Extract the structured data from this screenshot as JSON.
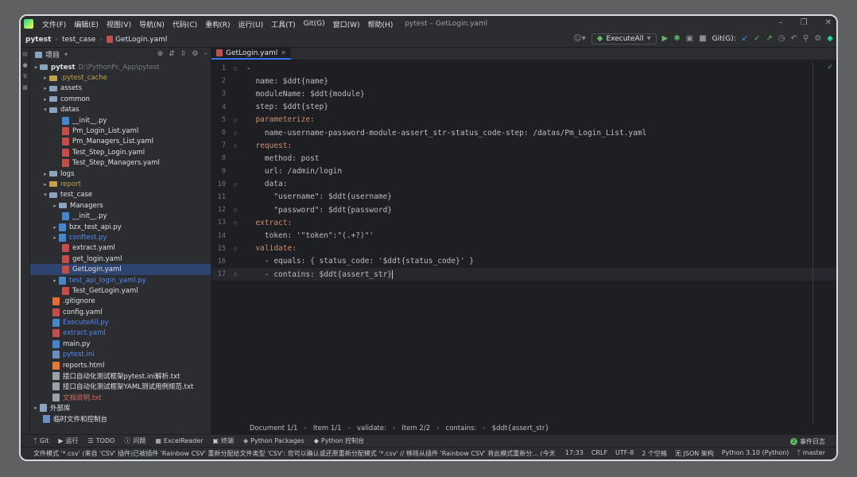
{
  "titlebar": {
    "menus": [
      "文件(F)",
      "编辑(E)",
      "视图(V)",
      "导航(N)",
      "代码(C)",
      "重构(R)",
      "运行(U)",
      "工具(T)",
      "Git(G)",
      "窗口(W)",
      "帮助(H)"
    ],
    "title": "pytest – GetLogin.yaml"
  },
  "navbar": {
    "crumbs": [
      "pytest",
      "test_case",
      "GetLogin.yaml"
    ],
    "run_config": "ExecuteAll",
    "git_label": "Git(G):"
  },
  "project": {
    "header": "项目",
    "root_name": "pytest",
    "root_path": "D:\\PythonPc_App\\pytest",
    "items": [
      {
        "label": ".pytest_cache"
      },
      {
        "label": "assets"
      },
      {
        "label": "common"
      },
      {
        "label": "datas"
      },
      {
        "label": "__init__.py"
      },
      {
        "label": "Pm_Login_List.yaml"
      },
      {
        "label": "Pm_Managers_List.yaml"
      },
      {
        "label": "Test_Step_Login.yaml"
      },
      {
        "label": "Test_Step_Managers.yaml"
      },
      {
        "label": "logs"
      },
      {
        "label": "report"
      },
      {
        "label": "test_case"
      },
      {
        "label": "Managers"
      },
      {
        "label": "__init__.py"
      },
      {
        "label": "bzx_test_api.py"
      },
      {
        "label": "conftest.py"
      },
      {
        "label": "extract.yaml"
      },
      {
        "label": "get_login.yaml"
      },
      {
        "label": "GetLogin.yaml"
      },
      {
        "label": "test_api_login_yaml.py"
      },
      {
        "label": "Test_GetLogin.yaml"
      },
      {
        "label": ".gitignore"
      },
      {
        "label": "config.yaml"
      },
      {
        "label": "ExecuteAll.py"
      },
      {
        "label": "extract.yaml"
      },
      {
        "label": "main.py"
      },
      {
        "label": "pytest.ini"
      },
      {
        "label": "reports.html"
      },
      {
        "label": "接口自动化测试框架pytest.ini解析.txt"
      },
      {
        "label": "接口自动化测试框架YAML测试用例规范.txt"
      },
      {
        "label": "文档说明.txt"
      },
      {
        "label": "外部库"
      },
      {
        "label": "临时文件和控制台"
      }
    ]
  },
  "editor": {
    "tab_label": "GetLogin.yaml",
    "lines": [
      {
        "n": "1",
        "t": "-"
      },
      {
        "n": "2",
        "t": "  name: $ddt{name}"
      },
      {
        "n": "3",
        "t": "  moduleName: $ddt{module}"
      },
      {
        "n": "4",
        "t": "  step: $ddt{step}"
      },
      {
        "n": "5",
        "t": "  parameterize:"
      },
      {
        "n": "6",
        "t": "    name-username-password-module-assert_str-status_code-step: /datas/Pm_Login_List.yaml"
      },
      {
        "n": "7",
        "t": "  request:"
      },
      {
        "n": "8",
        "t": "    method: post"
      },
      {
        "n": "9",
        "t": "    url: /admin/login"
      },
      {
        "n": "10",
        "t": "    data:"
      },
      {
        "n": "11",
        "t": "      \"username\": $ddt{username}"
      },
      {
        "n": "12",
        "t": "      \"password\": $ddt{password}"
      },
      {
        "n": "13",
        "t": "  extract:"
      },
      {
        "n": "14",
        "t": "    token: '\"token\":\"(.+?)\"'"
      },
      {
        "n": "15",
        "t": "  validate:"
      },
      {
        "n": "16",
        "t": "    - equals: { status_code: '$ddt{status_code}' }"
      },
      {
        "n": "17",
        "t": "    - contains: $ddt{assert_str}"
      }
    ],
    "breadcrumb": [
      "Document 1/1",
      "Item 1/1",
      "validate:",
      "Item 2/2",
      "contains:",
      "$ddt{assert_str}"
    ]
  },
  "toolwindows": {
    "items": [
      "Git",
      "运行",
      "TODO",
      "问题",
      "ExcelReader",
      "终端",
      "Python Packages",
      "Python 控制台"
    ],
    "event_log": "事件日志",
    "event_count": "2"
  },
  "statusbar": {
    "message": "文件模式 '*.csv' (来自 'CSV' 插件)已被插件 'Rainbow CSV' 重新分配给文件类型 'CSV': 您可以确认或还原重新分配模式 '*.csv' // 移除从插件 'Rainbow CSV' 将此模式重新分... (今天 10:09)",
    "position": "17:33",
    "line_sep": "CRLF",
    "encoding": "UTF-8",
    "indent": "2 个空格",
    "schema": "无 JSON 架构",
    "interpreter": "Python 3.10 (Python)",
    "branch": "master"
  },
  "colors": {
    "accent": "#3574f0",
    "selection": "#2e436e",
    "keyword": "#cf8e6d",
    "string": "#6aab73"
  }
}
